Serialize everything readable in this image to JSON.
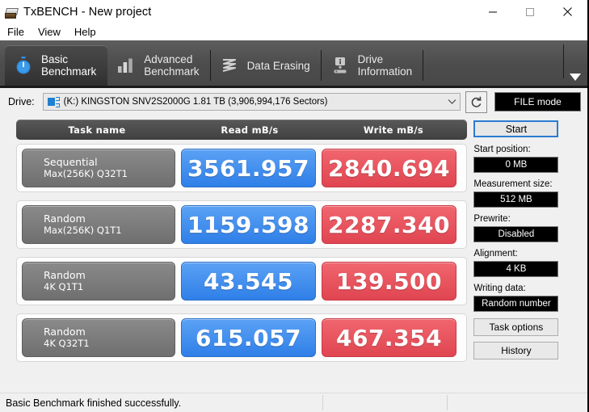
{
  "window": {
    "title": "TxBENCH - New project",
    "app_icon": "drive-icon",
    "minimize": "minimize-icon",
    "maximize": "maximize-icon",
    "close": "close-icon"
  },
  "menu": {
    "items": [
      {
        "label": "File"
      },
      {
        "label": "View"
      },
      {
        "label": "Help"
      }
    ]
  },
  "tabs": {
    "overflow_icon": "chevron-down-icon",
    "items": [
      {
        "label": "Basic\nBenchmark",
        "icon": "stopwatch-icon",
        "active": true
      },
      {
        "label": "Advanced\nBenchmark",
        "icon": "bar-chart-icon",
        "active": false
      },
      {
        "label": "Data Erasing",
        "icon": "eraser-wave-icon",
        "active": false
      },
      {
        "label": "Drive\nInformation",
        "icon": "drive-info-icon",
        "active": false
      }
    ]
  },
  "drive_row": {
    "label": "Drive:",
    "selected": "(K:) KINGSTON SNV2S2000G  1.81 TB (3,906,994,176 Sectors)",
    "combo_arrow": "chevron-down-icon",
    "refresh_icon": "refresh-icon",
    "file_mode": "FILE mode"
  },
  "table": {
    "headers": {
      "task": "Task name",
      "read": "Read mB/s",
      "write": "Write mB/s"
    },
    "rows": [
      {
        "task_line1": "Sequential",
        "task_line2": "Max(256K) Q32T1",
        "read": "3561.957",
        "write": "2840.694"
      },
      {
        "task_line1": "Random",
        "task_line2": "Max(256K) Q1T1",
        "read": "1159.598",
        "write": "2287.340"
      },
      {
        "task_line1": "Random",
        "task_line2": "4K Q1T1",
        "read": "43.545",
        "write": "139.500"
      },
      {
        "task_line1": "Random",
        "task_line2": "4K Q32T1",
        "read": "615.057",
        "write": "467.354"
      }
    ]
  },
  "sidebar": {
    "start_button": "Start",
    "start_position_label": "Start position:",
    "start_position_value": "0 MB",
    "measurement_size_label": "Measurement size:",
    "measurement_size_value": "512 MB",
    "prewrite_label": "Prewrite:",
    "prewrite_value": "Disabled",
    "alignment_label": "Alignment:",
    "alignment_value": "4 KB",
    "writing_data_label": "Writing data:",
    "writing_data_value": "Random number",
    "task_options_button": "Task options",
    "history_button": "History"
  },
  "status": {
    "message": "Basic Benchmark finished successfully."
  },
  "colors": {
    "read_accent": "#3b8aee",
    "write_accent": "#e8505b",
    "tabbar_bg": "#4c4c4c",
    "focus_ring": "#2b7cd3"
  }
}
